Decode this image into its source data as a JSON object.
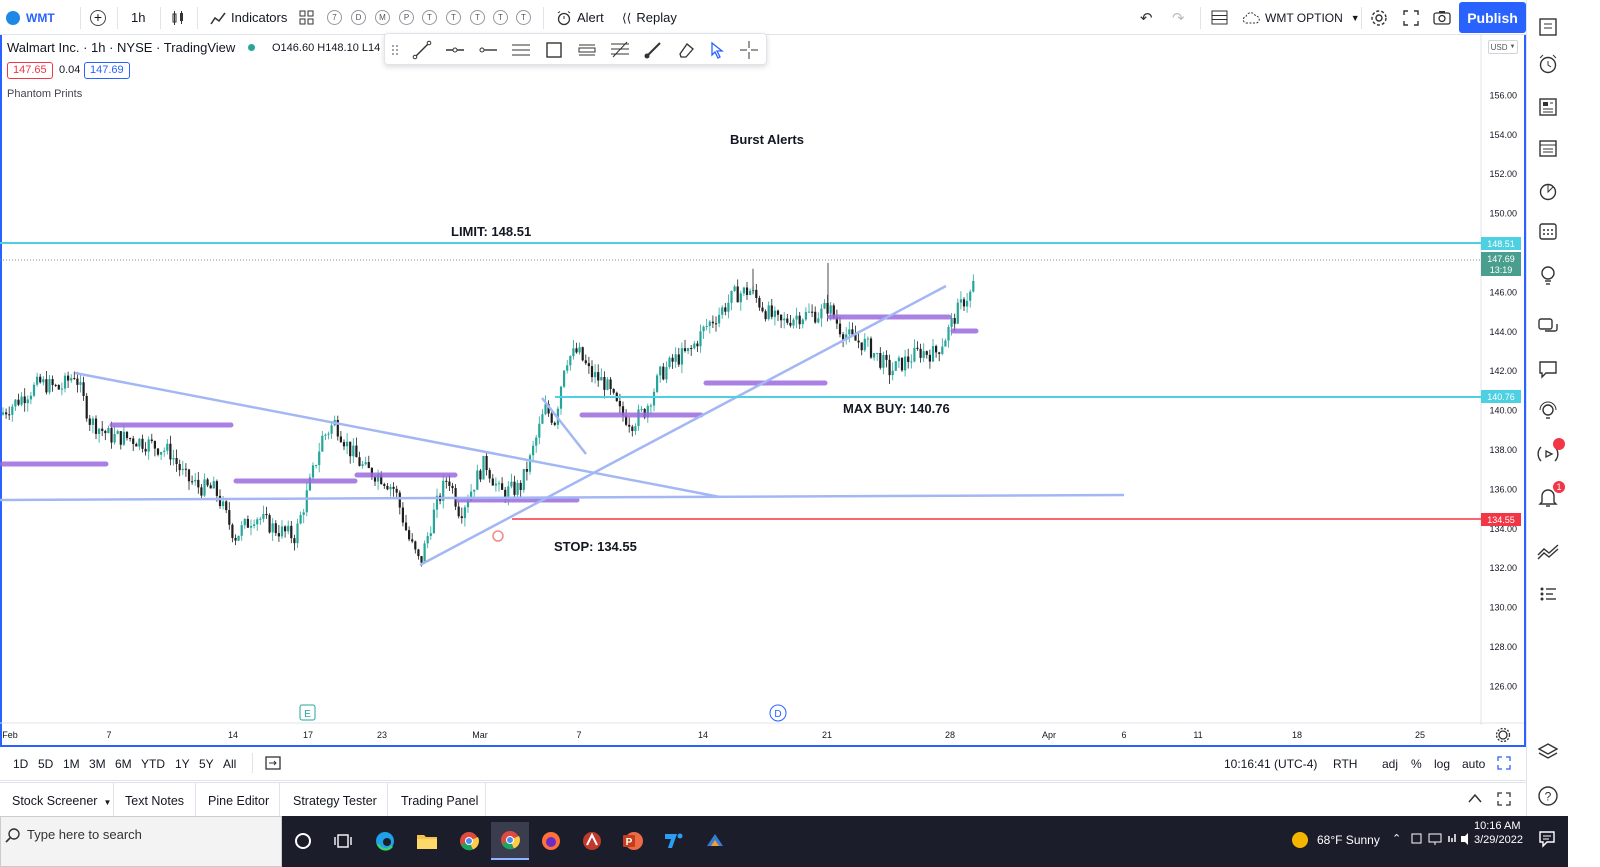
{
  "toolbar": {
    "symbol": "WMT",
    "interval": "1h",
    "indicators_label": "Indicators",
    "template_letters": [
      "7",
      "D",
      "M",
      "P",
      "T",
      "T",
      "T",
      "T",
      "T"
    ],
    "alert_label": "Alert",
    "replay_label": "Replay",
    "layout_name": "WMT OPTION",
    "publish_label": "Publish"
  },
  "legend": {
    "title": "Walmart Inc. · 1h · NYSE · TradingView",
    "ohlc": "O146.60 H148.10 L14",
    "bid": "147.65",
    "spread": "0.04",
    "ask": "147.69",
    "indicator_name": "Phantom Prints"
  },
  "currency_label": "USD",
  "chart_data": {
    "type": "candlestick",
    "symbol": "WMT",
    "interval": "1h",
    "y_ticks": [
      "156.00",
      "154.00",
      "152.00",
      "150.00",
      "146.00",
      "144.00",
      "142.00",
      "140.00",
      "138.00",
      "136.00",
      "134.00",
      "132.00",
      "130.00",
      "128.00",
      "126.00"
    ],
    "x_ticks": [
      "Feb",
      "7",
      "14",
      "17",
      "23",
      "Mar",
      "7",
      "14",
      "21",
      "28",
      "Apr",
      "6",
      "11",
      "18",
      "25"
    ],
    "last_price": "147.69",
    "countdown": "13:19",
    "levels": [
      {
        "value": 148.51,
        "label": "148.51",
        "annotation": "LIMIT: 148.51",
        "color": "#4dd0e1"
      },
      {
        "value": 140.76,
        "label": "140.76",
        "annotation": "MAX BUY: 140.76",
        "color": "#4dd0e1"
      },
      {
        "value": 134.55,
        "label": "134.55",
        "annotation": "STOP: 134.55",
        "color": "#f23645"
      }
    ],
    "overlay_text": "Burst Alerts",
    "event_markers": [
      "E",
      "D"
    ],
    "colors": {
      "up": "#26a69a",
      "down": "#1e1e1e",
      "prints": "#9c6ade",
      "trend": "#a3b7f5"
    }
  },
  "range_bar": {
    "ranges": [
      "1D",
      "5D",
      "1M",
      "3M",
      "6M",
      "YTD",
      "1Y",
      "5Y",
      "All"
    ],
    "time": "10:16:41 (UTC-4)",
    "session": "RTH",
    "options": [
      "adj",
      "%",
      "log",
      "auto"
    ]
  },
  "panels": [
    "Stock Screener",
    "Text Notes",
    "Pine Editor",
    "Strategy Tester",
    "Trading Panel"
  ],
  "taskbar": {
    "search_placeholder": "Type here to search",
    "weather": "68°F  Sunny",
    "time": "10:16 AM",
    "date": "3/29/2022"
  },
  "sidebar_badge": "1"
}
